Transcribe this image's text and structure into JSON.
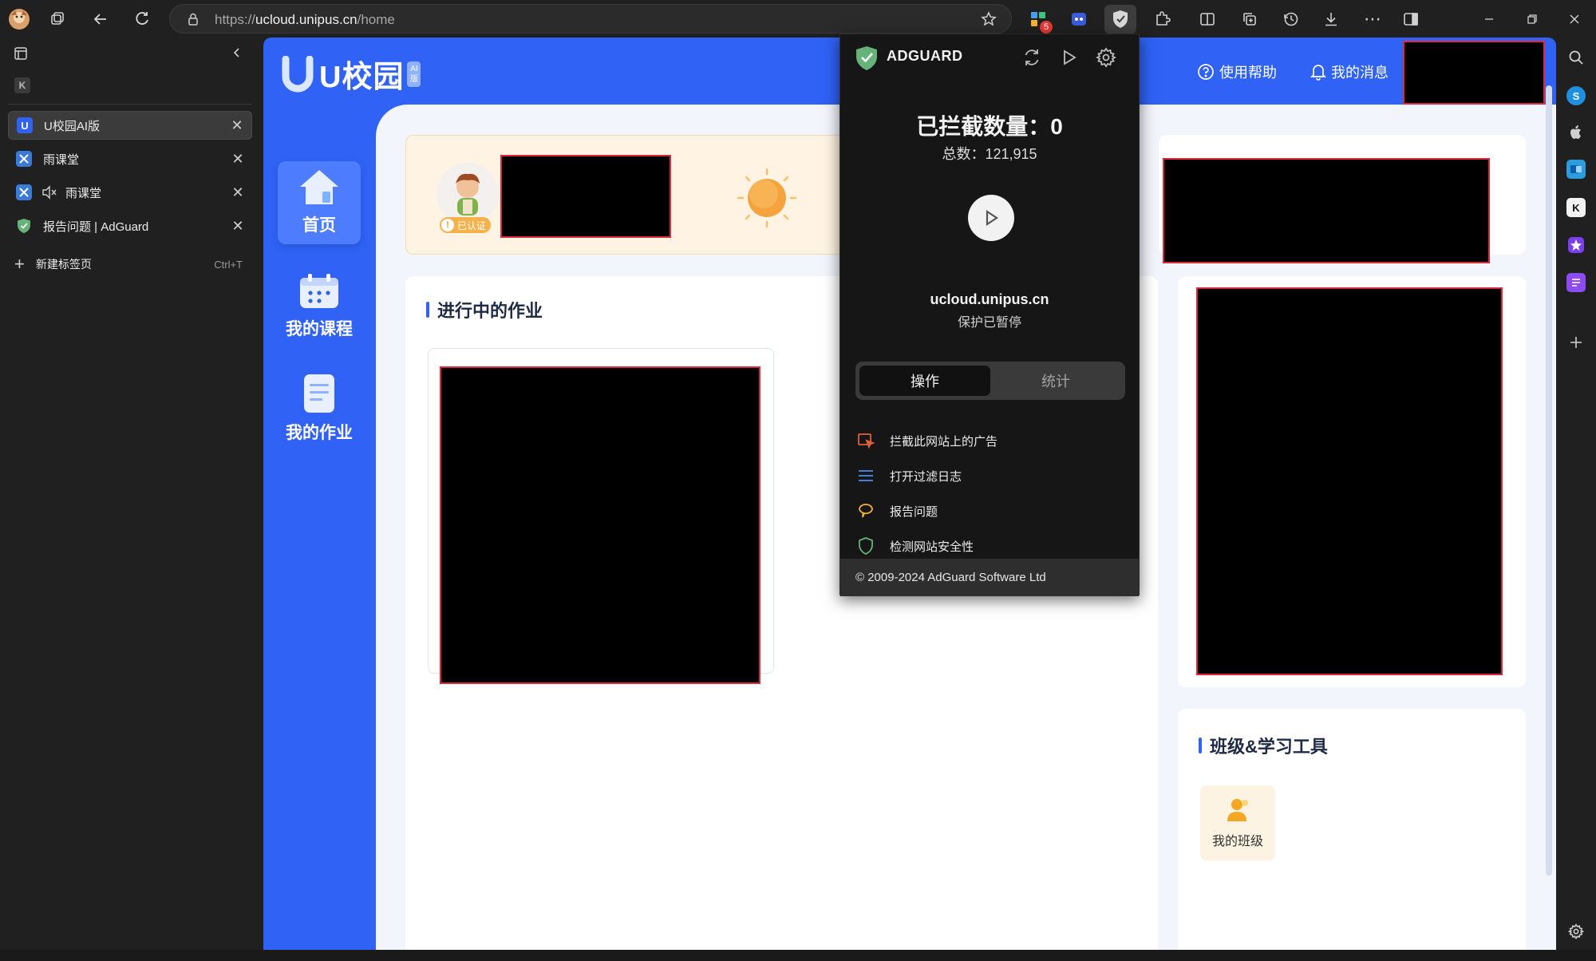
{
  "browser": {
    "url_prefix": "https://",
    "url_host": "ucloud.unipus.cn",
    "url_path": "/home",
    "extension_badge": "5",
    "window_controls": [
      "minimize",
      "restore",
      "close"
    ]
  },
  "tabs": {
    "items": [
      {
        "title": "U校园AI版",
        "active": true
      },
      {
        "title": "雨课堂",
        "active": false
      },
      {
        "title": "雨课堂",
        "active": false,
        "muted": true
      },
      {
        "title": "报告问题 | AdGuard",
        "active": false
      }
    ],
    "new_tab_label": "新建标签页",
    "new_tab_shortcut": "Ctrl+T"
  },
  "site": {
    "logo_text": "U校园",
    "logo_badge": "AI版",
    "header_help": "使用帮助",
    "header_messages": "我的消息",
    "nav": [
      {
        "label": "首页",
        "active": true
      },
      {
        "label": "我的课程",
        "active": false
      },
      {
        "label": "我的作业",
        "active": false
      }
    ],
    "verified_badge": "已认证",
    "homework_title": "进行中的作业",
    "tools_title": "班级&学习工具",
    "tool_my_class": "我的班级"
  },
  "adguard": {
    "brand": "ADGUARD",
    "blocked_label": "已拦截数量：",
    "blocked_count": "0",
    "total_label": "总数：",
    "total_count": "121,915",
    "domain": "ucloud.unipus.cn",
    "status": "保护已暂停",
    "tab_actions": "操作",
    "tab_stats": "统计",
    "actions": [
      {
        "label": "拦截此网站上的广告",
        "icon": "block-ad-icon"
      },
      {
        "label": "打开过滤日志",
        "icon": "filter-log-icon"
      },
      {
        "label": "报告问题",
        "icon": "report-icon"
      },
      {
        "label": "检测网站安全性",
        "icon": "security-check-icon"
      }
    ],
    "footer": "© 2009-2024 AdGuard Software Ltd"
  },
  "colors": {
    "brand_blue": "#2f62f5",
    "adguard_green": "#67b279",
    "redaction_border": "#e0283c"
  }
}
